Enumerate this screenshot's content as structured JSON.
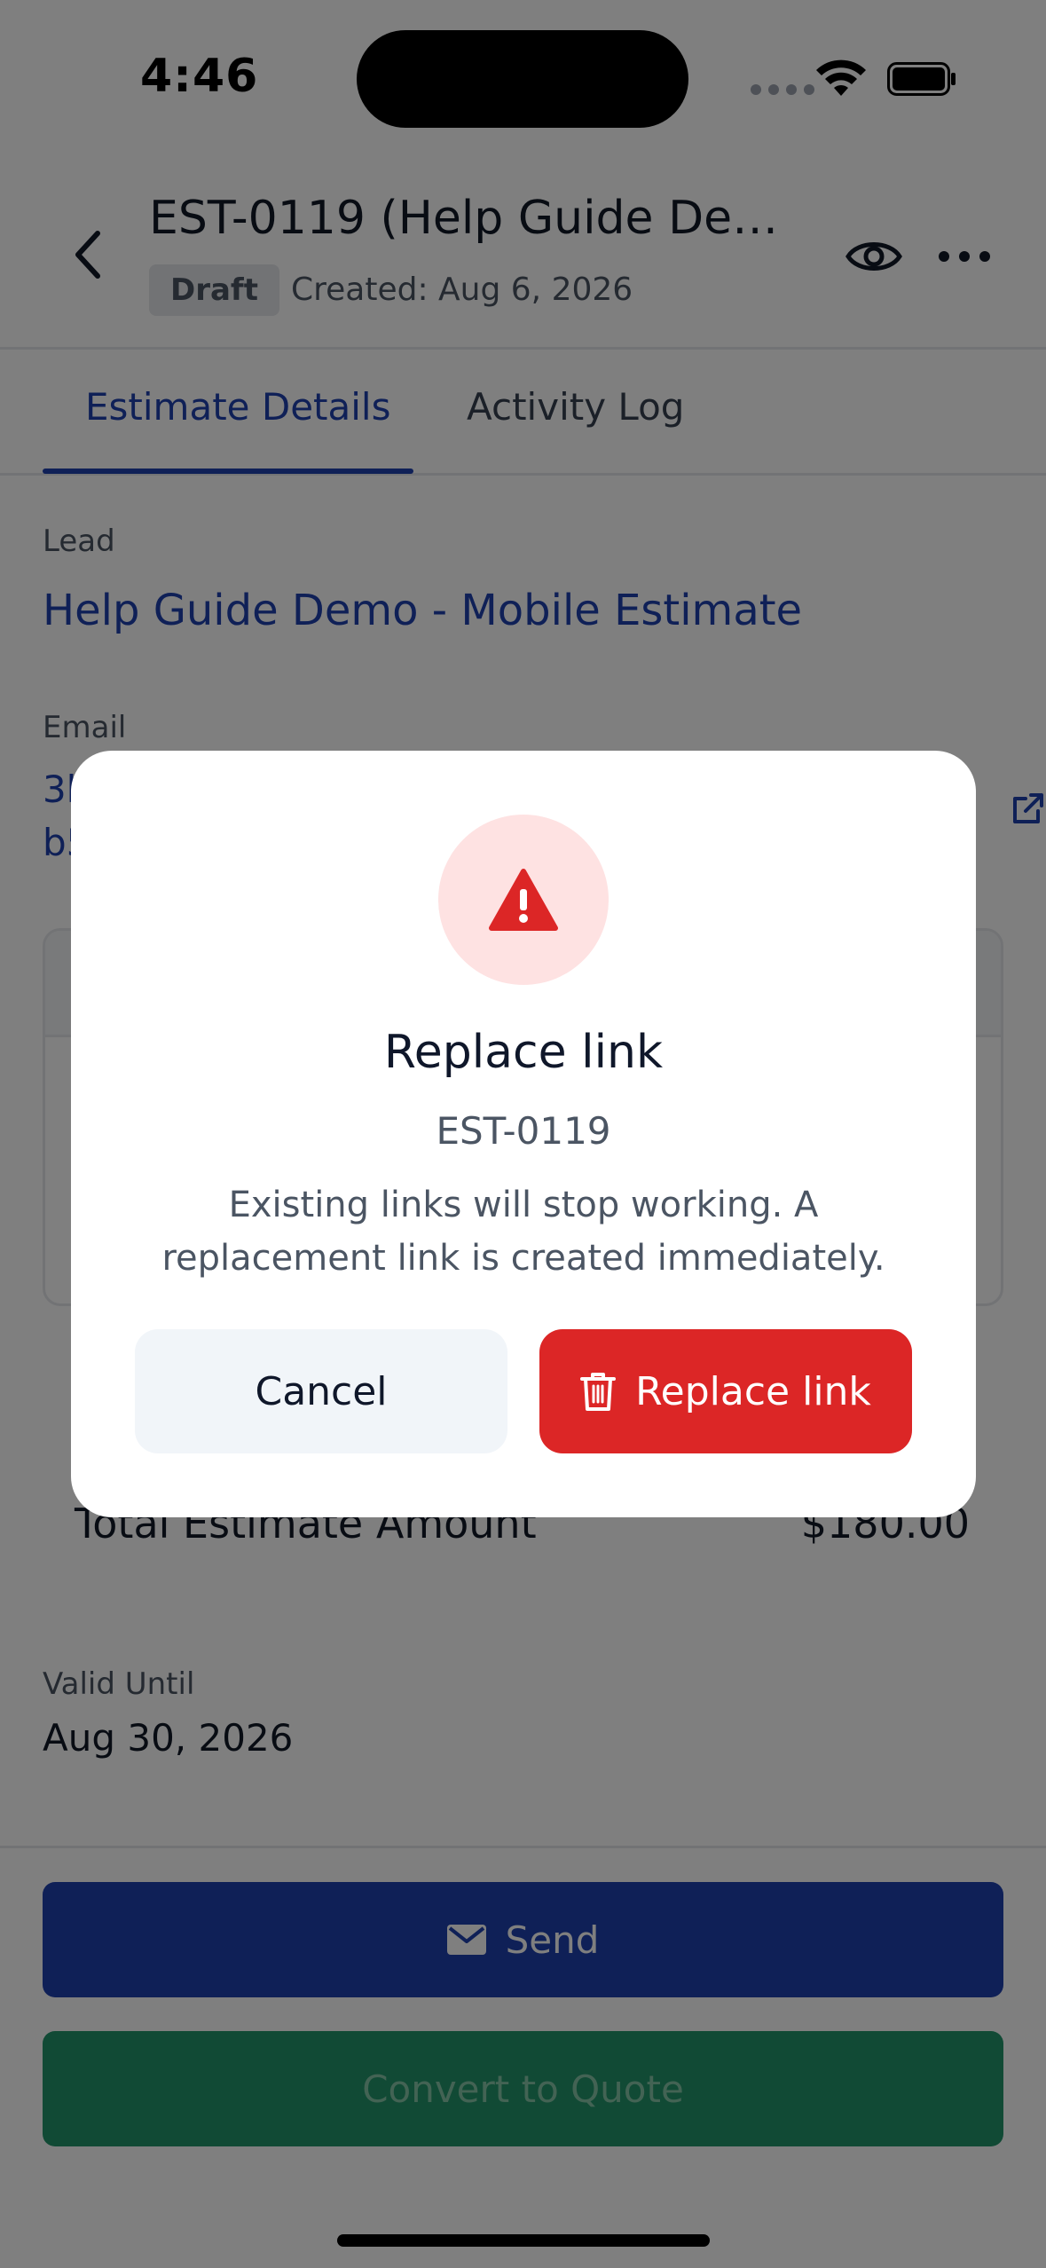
{
  "status_bar": {
    "time": "4:46"
  },
  "header": {
    "title": "EST-0119 (Help Guide Demo...",
    "badge": "Draft",
    "created": "Created: Aug 6, 2026"
  },
  "tabs": [
    {
      "label": "Estimate Details",
      "active": true
    },
    {
      "label": "Activity Log",
      "active": false
    }
  ],
  "details": {
    "lead_label": "Lead",
    "lead_value": "Help Guide Demo - Mobile Estimate",
    "email_label": "Email",
    "email_value_line1": "3k",
    "email_value_line2": "b5",
    "total_label": "Total Estimate Amount",
    "total_value": "$180.00",
    "valid_label": "Valid Until",
    "valid_value": "Aug 30, 2026"
  },
  "footer": {
    "send_label": "Send",
    "convert_label": "Convert to Quote"
  },
  "modal": {
    "title": "Replace link",
    "subtitle": "EST-0119",
    "message": "Existing links will stop working. A replacement link is created immediately.",
    "cancel_label": "Cancel",
    "confirm_label": "Replace link"
  },
  "colors": {
    "accent": "#1e40af",
    "danger": "#dc2626",
    "success": "#22946a"
  }
}
